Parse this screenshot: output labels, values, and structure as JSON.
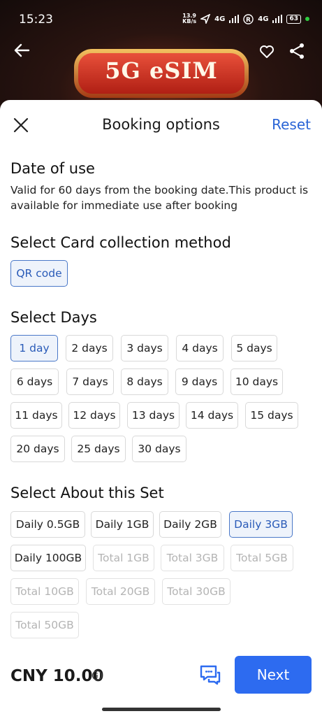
{
  "status_bar": {
    "time": "15:23",
    "speed_value": "13.9",
    "speed_unit": "KB/s",
    "network1": "4G",
    "network2": "4G",
    "battery": "63"
  },
  "banner": {
    "text": "5G eSIM"
  },
  "sheet": {
    "title": "Booking options",
    "reset_label": "Reset"
  },
  "date_of_use": {
    "title": "Date of use",
    "description": "Valid for 60 days from the booking date.This product is available for immediate use after booking"
  },
  "collection": {
    "title": "Select Card collection method",
    "options": [
      {
        "label": "QR code",
        "state": "selected"
      }
    ]
  },
  "days": {
    "title": "Select Days",
    "options": [
      {
        "label": "1 day",
        "state": "selected"
      },
      {
        "label": "2 days",
        "state": "normal"
      },
      {
        "label": "3 days",
        "state": "normal"
      },
      {
        "label": "4 days",
        "state": "normal"
      },
      {
        "label": "5 days",
        "state": "normal"
      },
      {
        "label": "6 days",
        "state": "normal"
      },
      {
        "label": "7 days",
        "state": "normal"
      },
      {
        "label": "8 days",
        "state": "normal"
      },
      {
        "label": "9 days",
        "state": "normal"
      },
      {
        "label": "10 days",
        "state": "normal"
      },
      {
        "label": "11 days",
        "state": "normal"
      },
      {
        "label": "12 days",
        "state": "normal"
      },
      {
        "label": "13 days",
        "state": "normal"
      },
      {
        "label": "14 days",
        "state": "normal"
      },
      {
        "label": "15 days",
        "state": "normal"
      },
      {
        "label": "20 days",
        "state": "normal"
      },
      {
        "label": "25 days",
        "state": "normal"
      },
      {
        "label": "30 days",
        "state": "normal"
      }
    ]
  },
  "set": {
    "title": "Select About this Set",
    "options": [
      {
        "label": "Daily 0.5GB",
        "state": "normal"
      },
      {
        "label": "Daily 1GB",
        "state": "normal"
      },
      {
        "label": "Daily 2GB",
        "state": "normal"
      },
      {
        "label": "Daily 3GB",
        "state": "selected"
      },
      {
        "label": "Daily 100GB",
        "state": "normal"
      },
      {
        "label": "Total 1GB",
        "state": "disabled"
      },
      {
        "label": "Total 3GB",
        "state": "disabled"
      },
      {
        "label": "Total 5GB",
        "state": "disabled"
      },
      {
        "label": "Total 10GB",
        "state": "disabled"
      },
      {
        "label": "Total 20GB",
        "state": "disabled"
      },
      {
        "label": "Total 30GB",
        "state": "disabled"
      },
      {
        "label": "Total 50GB",
        "state": "disabled"
      }
    ]
  },
  "footer": {
    "price": "CNY 10.00",
    "next_label": "Next"
  },
  "colors": {
    "accent": "#2d6bf0",
    "link": "#2a64d6",
    "selected_border": "#4a78c8",
    "selected_bg": "#eef3fb"
  },
  "icons": [
    "back-arrow-icon",
    "heart-icon",
    "share-icon",
    "close-icon",
    "info-icon",
    "chat-icon"
  ]
}
